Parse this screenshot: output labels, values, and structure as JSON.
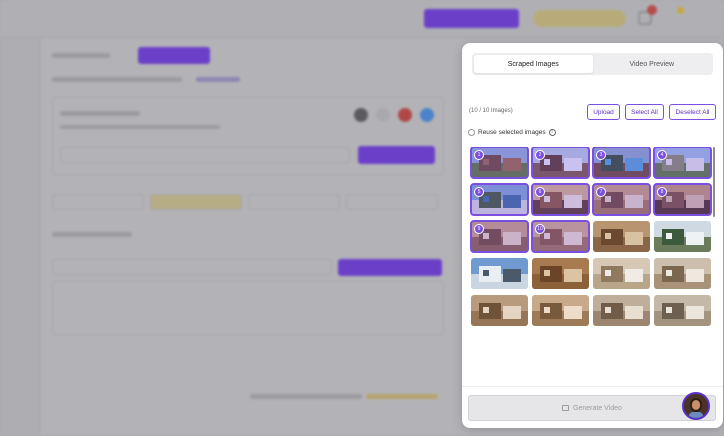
{
  "panel": {
    "tabs": [
      {
        "label": "Scraped Images",
        "active": true
      },
      {
        "label": "Video Preview",
        "active": false
      }
    ],
    "count_label": "(10 / 10 Images)",
    "buttons": {
      "upload": "Upload",
      "select_all": "Select All",
      "deselect_all": "Deselect All"
    },
    "reuse_label": "Reuse selected images",
    "info_icon": "i",
    "images": [
      {
        "badge": "1",
        "selected": true,
        "scene": "house-exterior"
      },
      {
        "badge": "2",
        "selected": true,
        "scene": "house-snow"
      },
      {
        "badge": "3",
        "selected": true,
        "scene": "pool-forest"
      },
      {
        "badge": "4",
        "selected": true,
        "scene": "mountain-valley"
      },
      {
        "badge": "5",
        "selected": true,
        "scene": "mountain-lake"
      },
      {
        "badge": "6",
        "selected": true,
        "scene": "kitchen"
      },
      {
        "badge": "7",
        "selected": true,
        "scene": "living-room"
      },
      {
        "badge": "8",
        "selected": true,
        "scene": "dining-room"
      },
      {
        "badge": "9",
        "selected": true,
        "scene": "living-room-fireplace"
      },
      {
        "badge": "10",
        "selected": true,
        "scene": "interior-room"
      },
      {
        "badge": "",
        "selected": false,
        "scene": "den"
      },
      {
        "badge": "",
        "selected": false,
        "scene": "snowy-trees"
      },
      {
        "badge": "",
        "selected": false,
        "scene": "snowy-mountain"
      },
      {
        "badge": "",
        "selected": false,
        "scene": "hallway-wood"
      },
      {
        "badge": "",
        "selected": false,
        "scene": "bathroom"
      },
      {
        "badge": "",
        "selected": false,
        "scene": "bedroom"
      },
      {
        "badge": "",
        "selected": false,
        "scene": "loft"
      },
      {
        "badge": "",
        "selected": false,
        "scene": "staircase"
      },
      {
        "badge": "",
        "selected": false,
        "scene": "bedroom-2"
      },
      {
        "badge": "",
        "selected": false,
        "scene": "bedroom-3"
      }
    ],
    "generate_label": "Generate Video"
  },
  "colors": {
    "accent": "#7b4fe0",
    "accent_dark": "#5b2fc9",
    "overlay_bg": "#b3b3b7"
  }
}
